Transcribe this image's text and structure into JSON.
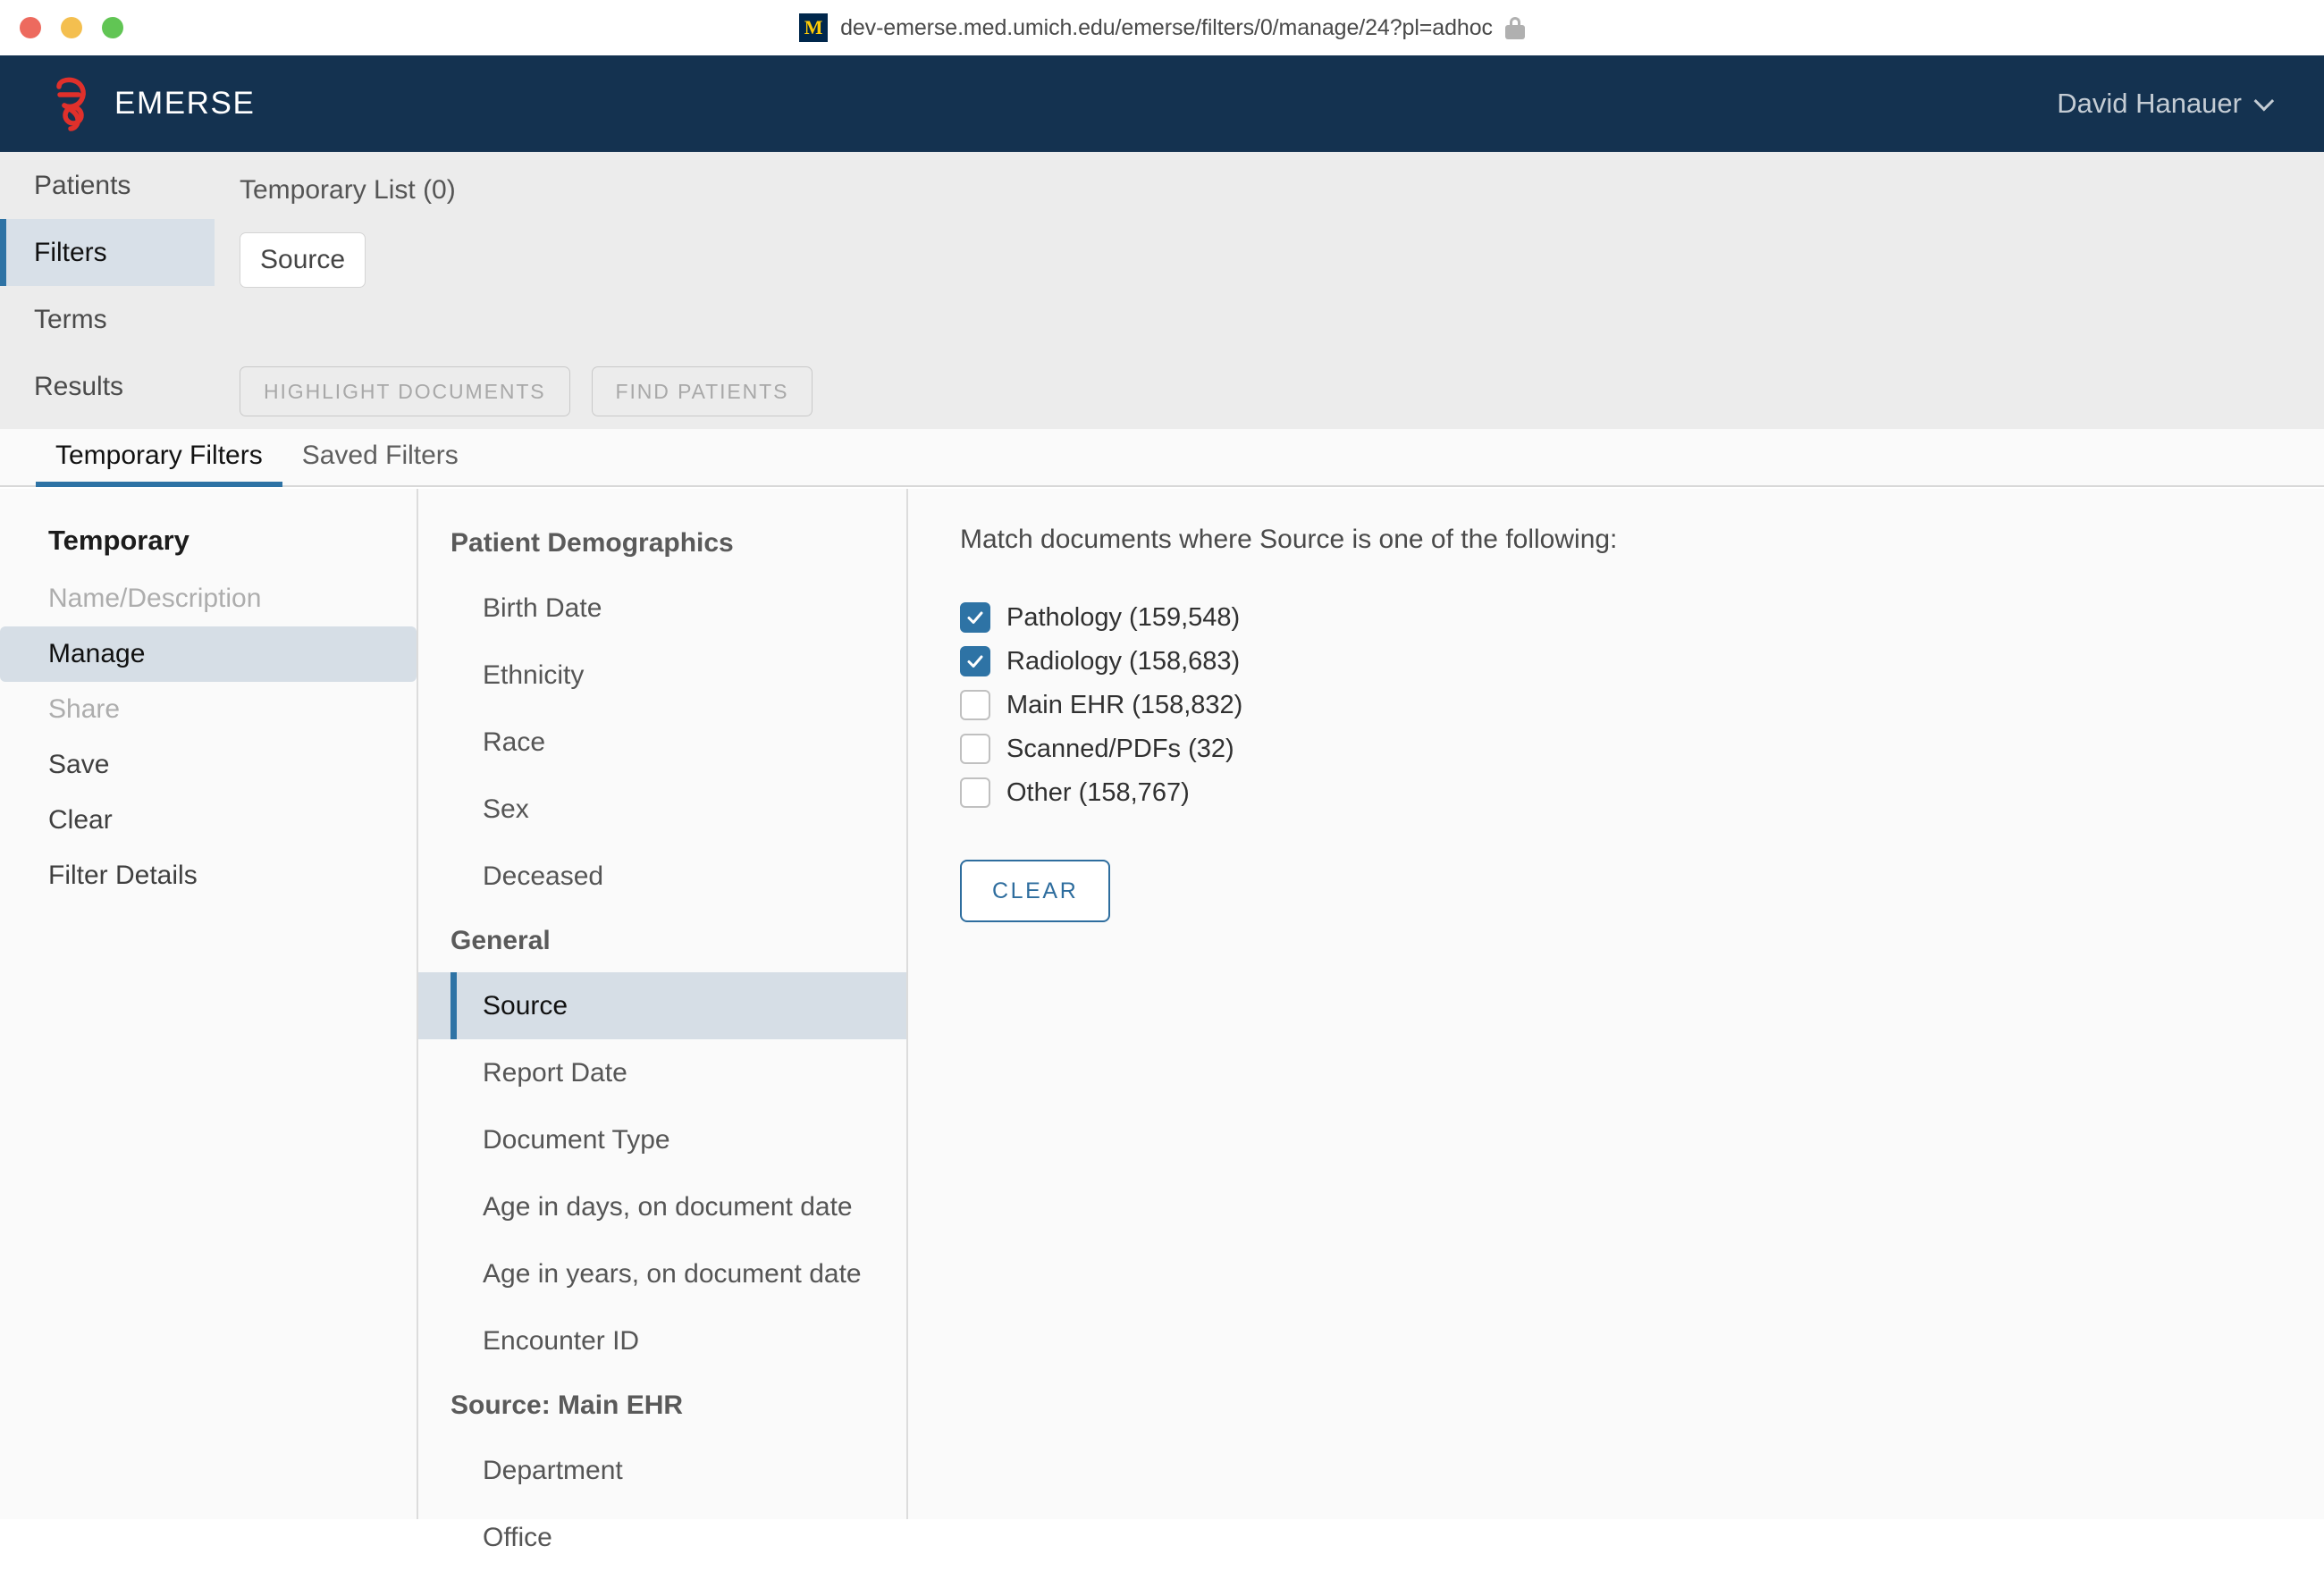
{
  "browser": {
    "url": "dev-emerse.med.umich.edu/emerse/filters/0/manage/24?pl=adhoc",
    "favicon_letter": "M",
    "lock_icon": "lock-icon",
    "traffic_lights": [
      "close",
      "minimize",
      "maximize"
    ]
  },
  "header": {
    "brand": "EMERSE",
    "logo_icon": "emerse-logo-icon",
    "user": "David Hanauer",
    "chevron_icon": "chevron-down-icon"
  },
  "nav": {
    "items": [
      {
        "label": "Patients",
        "active": false
      },
      {
        "label": "Filters",
        "active": true
      },
      {
        "label": "Terms",
        "active": false
      },
      {
        "label": "Results",
        "active": false
      }
    ]
  },
  "toolbar": {
    "temporary_list": "Temporary List (0)",
    "chips": [
      "Source"
    ],
    "buttons": [
      {
        "label": "HIGHLIGHT DOCUMENTS",
        "disabled": true
      },
      {
        "label": "FIND PATIENTS",
        "disabled": true
      }
    ]
  },
  "tabs": [
    {
      "label": "Temporary Filters",
      "active": true
    },
    {
      "label": "Saved Filters",
      "active": false
    }
  ],
  "sidebar": {
    "title": "Temporary",
    "items": [
      {
        "label": "Name/Description",
        "state": "disabled"
      },
      {
        "label": "Manage",
        "state": "selected"
      },
      {
        "label": "Share",
        "state": "disabled"
      },
      {
        "label": "Save",
        "state": "normal"
      },
      {
        "label": "Clear",
        "state": "normal"
      },
      {
        "label": "Filter Details",
        "state": "normal"
      }
    ]
  },
  "field_list": {
    "groups": [
      {
        "heading": "Patient Demographics",
        "fields": [
          {
            "label": "Birth Date",
            "selected": false
          },
          {
            "label": "Ethnicity",
            "selected": false
          },
          {
            "label": "Race",
            "selected": false
          },
          {
            "label": "Sex",
            "selected": false
          },
          {
            "label": "Deceased",
            "selected": false
          }
        ]
      },
      {
        "heading": "General",
        "fields": [
          {
            "label": "Source",
            "selected": true
          },
          {
            "label": "Report Date",
            "selected": false
          },
          {
            "label": "Document Type",
            "selected": false
          },
          {
            "label": "Age in days, on document date",
            "selected": false
          },
          {
            "label": "Age in years, on document date",
            "selected": false
          },
          {
            "label": "Encounter ID",
            "selected": false
          }
        ]
      },
      {
        "heading": "Source: Main EHR",
        "fields": [
          {
            "label": "Department",
            "selected": false
          },
          {
            "label": "Office",
            "selected": false
          }
        ]
      }
    ]
  },
  "detail": {
    "prompt": "Match documents where Source is one of the following:",
    "options": [
      {
        "label": "Pathology (159,548)",
        "checked": true
      },
      {
        "label": "Radiology (158,683)",
        "checked": true
      },
      {
        "label": "Main EHR (158,832)",
        "checked": false
      },
      {
        "label": "Scanned/PDFs (32)",
        "checked": false
      },
      {
        "label": "Other (158,767)",
        "checked": false
      }
    ],
    "clear_label": "CLEAR"
  },
  "colors": {
    "header_bg": "#143250",
    "accent_blue": "#2e73a5",
    "logo_red": "#e0302b",
    "selected_bg": "#d6dee6",
    "toolbar_bg": "#ececec"
  }
}
